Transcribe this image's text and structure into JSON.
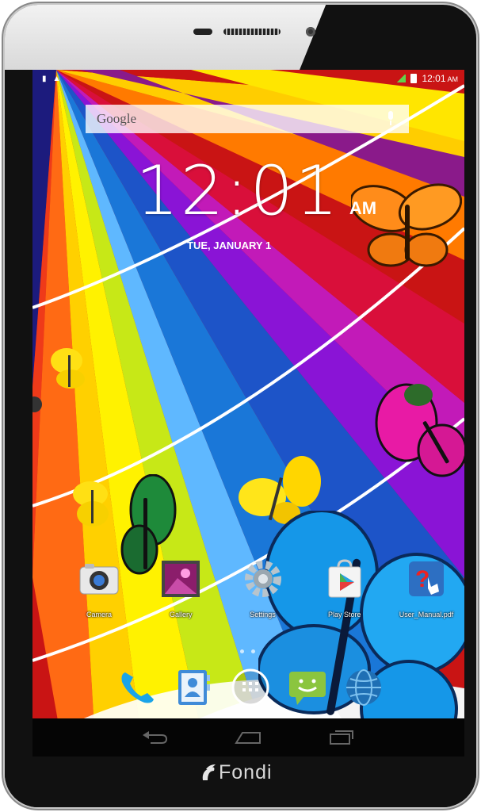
{
  "device": {
    "brand": "Fondi"
  },
  "status_bar": {
    "time": "12:01",
    "ampm": "AM"
  },
  "search": {
    "label": "Google"
  },
  "clock": {
    "time": "12:01",
    "ampm": "AM",
    "date": "TUE, JANUARY 1"
  },
  "apps": [
    {
      "label": "Camera",
      "icon": "camera-icon"
    },
    {
      "label": "Gallery",
      "icon": "gallery-icon"
    },
    {
      "label": "Settings",
      "icon": "settings-icon"
    },
    {
      "label": "Play Store",
      "icon": "play-store-icon"
    },
    {
      "label": "User_Manual.pdf",
      "icon": "pdf-help-icon"
    }
  ],
  "dock": [
    "phone-icon",
    "contacts-icon",
    "all-apps-icon",
    "messaging-icon",
    "browser-icon"
  ],
  "nav": [
    "back-icon",
    "home-icon",
    "recents-icon"
  ],
  "colors": {
    "wallpaper_red": "#c91414",
    "nav_bar": "#050505",
    "status_icon_green": "#62d24a"
  }
}
